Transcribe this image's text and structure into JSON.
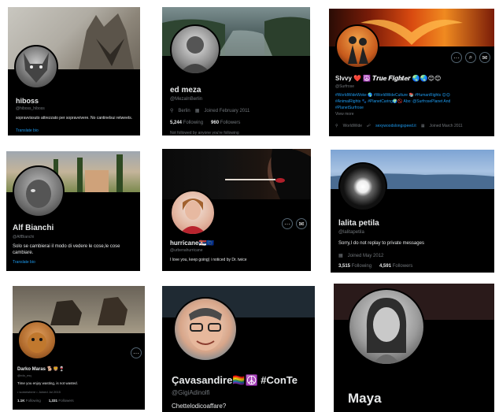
{
  "cards": [
    {
      "name": "hiboss",
      "handle": "@hiboss_hiboss",
      "bio": "sopravvissuto attrezzato per sopravvivere. No cantinelsui retweets.",
      "translate": "Translate bio"
    },
    {
      "name": "ed meza",
      "handle": "@MezaInBerlin",
      "location": "Berlin",
      "joined": "Joined February 2011",
      "following_count": "5,244",
      "following_label": "Following",
      "followers_count": "960",
      "followers_label": "Followers",
      "not_followed": "Not followed by anyone you're following"
    },
    {
      "name": "Slvvy ❤️ ☮️ 𝑻𝒓𝒖𝒆 𝑭𝒊𝒈𝒉𝒕𝒆𝒓 🌏🌏😊😊",
      "handle": "@Surfrose",
      "bio1": "#WorldWideWoke 🌎 #WorldWideCulture 📚 #HumanRights 😊😊",
      "bio2": "#AnimalRights 🐾 #PlanetCaring🌍🚫 Abo: @SurfrosePlanet And",
      "bio3": "#PlanetSurfrose",
      "bio_more": "View more",
      "location": "WorldWide",
      "website": "sexywoodslongspeed.it",
      "joined": "Joined March 2011"
    },
    {
      "name": "Alf Bianchi",
      "handle": "@AlfBianchi",
      "bio": "Solo se cambierai il modo di vedere le cose,le cose cambiare.",
      "translate": "Translate bio"
    },
    {
      "name": "hurricane🇷🇸🇪🇺",
      "handle": "@urbenahurricane",
      "bio": "I love you, keep going) i noticed by Dr. twice"
    },
    {
      "name": "lalita petila",
      "handle": "@lalitapetila",
      "bio": "Sorry,I do not replay to private messages",
      "joined": "Joined May 2012",
      "following_count": "3,515",
      "following_label": "Following",
      "followers_count": "4,591",
      "followers_label": "Followers"
    },
    {
      "name": "Darko Maras 🐕🦁🍷",
      "handle": "@rdo_mq",
      "bio": "Time you enjoy wasting, is not wasted.",
      "meta": "• somewhere   • Joined Jul 2015",
      "following_count": "1.1K",
      "following_label": "Following",
      "followers_count": "1,331",
      "followers_label": "Followers"
    },
    {
      "name": "Çavasandire🏳️‍🌈☮️ #ConTe",
      "handle": "@GigiAdinolfi",
      "bio": "Chettelodicoaffare?"
    },
    {
      "name": "Maya"
    }
  ],
  "icons": {
    "more": "···",
    "search": "⌕",
    "mail": "✉",
    "location": "⚲",
    "calendar": "▦",
    "link": "☍"
  },
  "colors": {
    "background": "#000000",
    "text": "#e7e9ea",
    "muted": "#71767b",
    "accent": "#1d9bf0"
  }
}
